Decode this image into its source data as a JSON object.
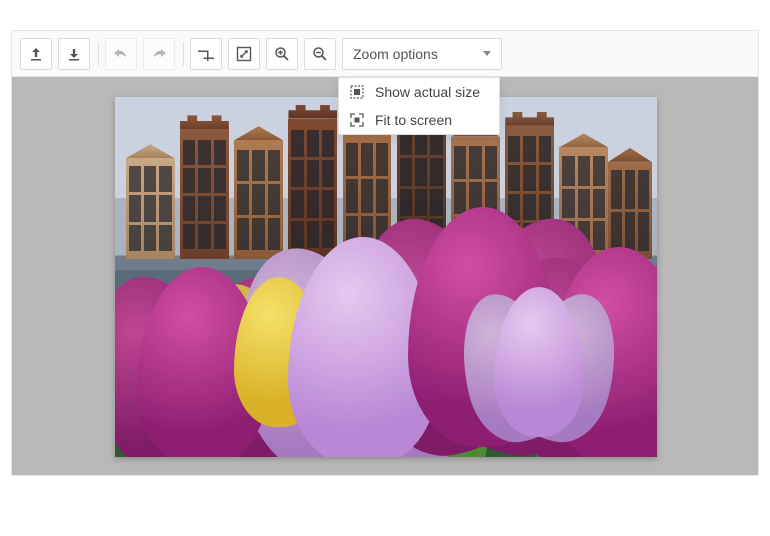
{
  "toolbar": {
    "buttons": {
      "upload": "upload-icon",
      "download": "download-icon",
      "undo": "undo-icon",
      "redo": "redo-icon",
      "crop": "crop-icon",
      "resize": "resize-icon",
      "zoom_in": "zoom-in-icon",
      "zoom_out": "zoom-out-icon"
    },
    "zoom_dropdown": {
      "label": "Zoom options",
      "items": [
        {
          "icon": "actual-size-icon",
          "label": "Show actual size"
        },
        {
          "icon": "fit-screen-icon",
          "label": "Fit to screen"
        }
      ]
    }
  }
}
